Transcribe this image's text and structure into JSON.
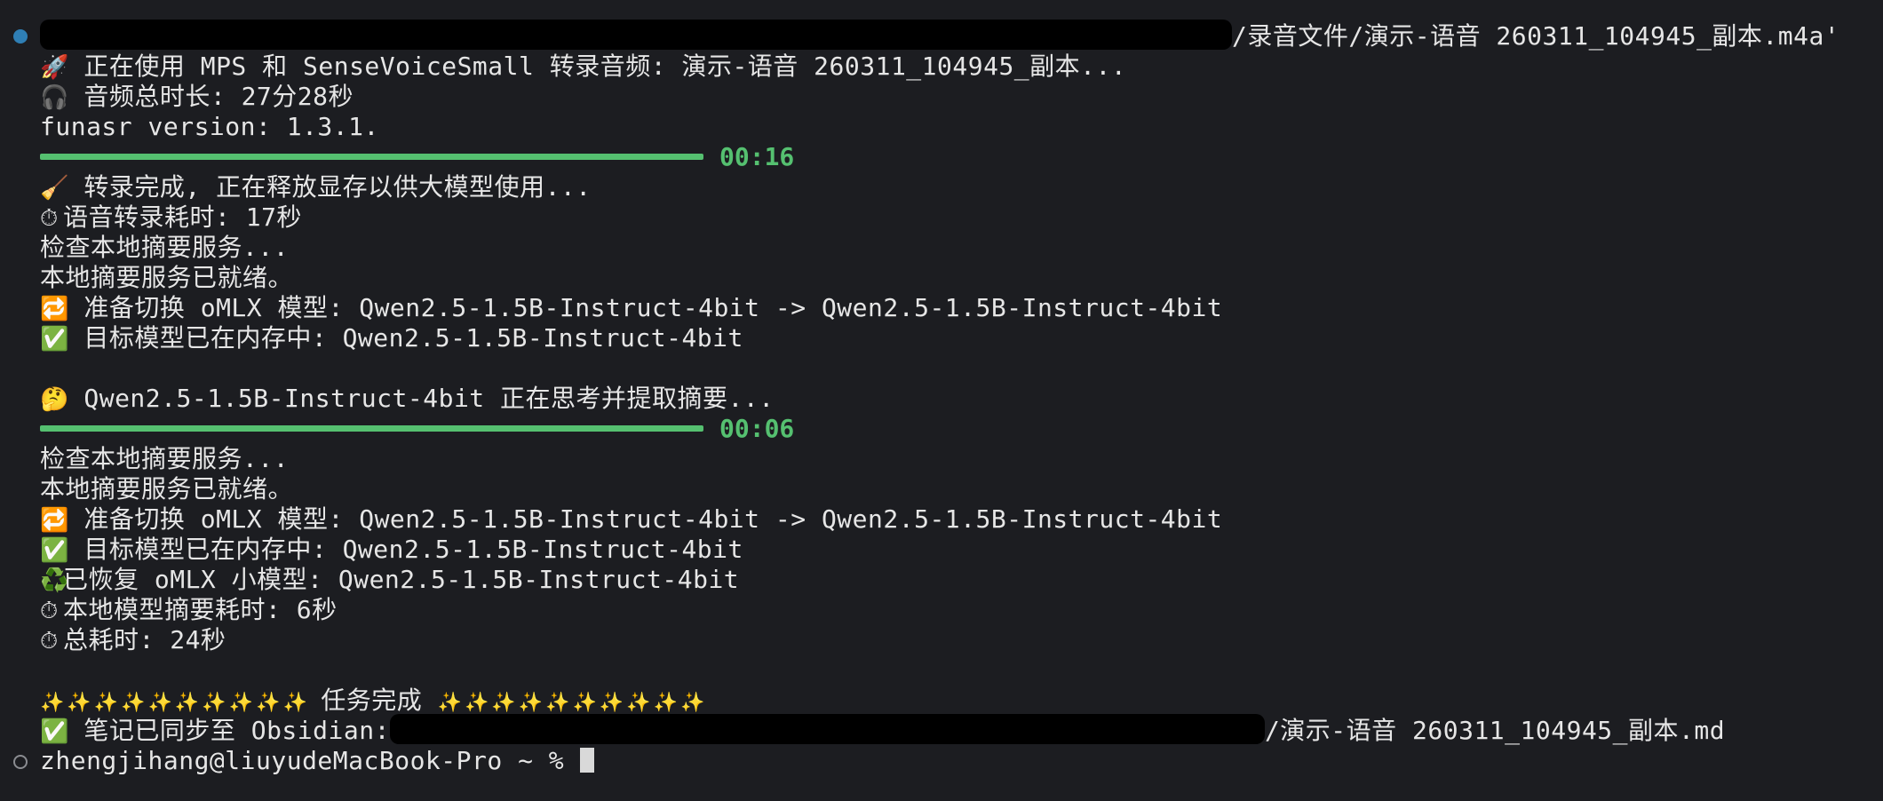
{
  "lines": {
    "l1_path": "/录音文件/演示-语音 260311_104945_副本.m4a'",
    "l2_text": "正在使用 MPS 和 SenseVoiceSmall 转录音频: 演示-语音 260311_104945_副本...",
    "l3_text": "音频总时长: 27分28秒",
    "l4_text": "funasr version: 1.3.1.",
    "l6_text": "转录完成, 正在释放显存以供大模型使用...",
    "l7_text": "语音转录耗时: 17秒",
    "l8_text": "检查本地摘要服务...",
    "l9_text": "本地摘要服务已就绪。",
    "l10_text": "准备切换 oMLX 模型: Qwen2.5-1.5B-Instruct-4bit -> Qwen2.5-1.5B-Instruct-4bit",
    "l11_text": "目标模型已在内存中: Qwen2.5-1.5B-Instruct-4bit",
    "l13_text": "Qwen2.5-1.5B-Instruct-4bit 正在思考并提取摘要...",
    "l15_text": "检查本地摘要服务...",
    "l16_text": "本地摘要服务已就绪。",
    "l17_text": "准备切换 oMLX 模型: Qwen2.5-1.5B-Instruct-4bit -> Qwen2.5-1.5B-Instruct-4bit",
    "l18_text": "目标模型已在内存中: Qwen2.5-1.5B-Instruct-4bit",
    "l19_text": "已恢复 oMLX 小模型: Qwen2.5-1.5B-Instruct-4bit",
    "l20_text": "本地模型摘要耗时: 6秒",
    "l21_text": "总耗时: 24秒",
    "l23_text": "任务完成",
    "l24_label": "笔记已同步至 Obsidian:",
    "l24_path": "/演示-语音 260311_104945_副本.md",
    "prompt": "zhengjihang@liuyudeMacBook-Pro ~ % "
  },
  "progress": [
    {
      "time": "00:16",
      "fraction": 1.0
    },
    {
      "time": "00:06",
      "fraction": 1.0
    }
  ],
  "sparkles": "✨ ✨ ✨ ✨ ✨ ✨ ✨ ✨ ✨ ✨",
  "colors": {
    "background": "#1c1d21",
    "text": "#e6e6e6",
    "progress_green": "#55c070",
    "marker_blue": "#2f7fb5"
  },
  "icons": [
    "rocket-icon",
    "headphones-icon",
    "broom-icon",
    "stopwatch-icon",
    "repeat-icon",
    "check-icon",
    "thinking-face-icon",
    "recycle-icon",
    "sparkles-icon"
  ]
}
